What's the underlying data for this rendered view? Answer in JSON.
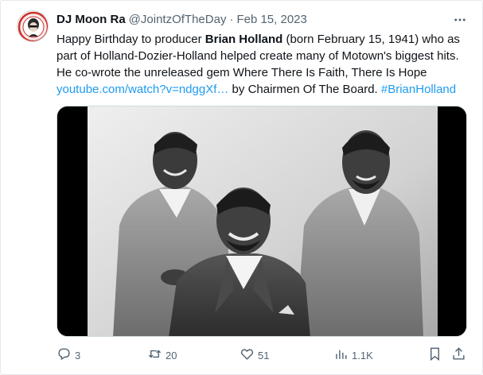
{
  "author": {
    "name": "DJ Moon Ra",
    "handle": "@JointzOfTheDay",
    "separator": "·",
    "date": "Feb 15, 2023"
  },
  "tweet": {
    "part1": "Happy Birthday to producer ",
    "bold_name": "Brian Holland",
    "part2": " (born February 15, 1941) who as part of Holland-Dozier-Holland helped create many of Motown's biggest hits. He co-wrote the unreleased gem Where There Is Faith, There Is Hope ",
    "link": "youtube.com/watch?v=ndggXf…",
    "part3": " by Chairmen Of The Board. ",
    "hashtag": "#BrianHolland"
  },
  "actions": {
    "replies": "3",
    "reposts": "20",
    "likes": "51",
    "views": "1.1K"
  },
  "icons": {
    "more": "more-icon",
    "reply": "reply-icon",
    "repost": "repost-icon",
    "like": "heart-icon",
    "views": "views-icon",
    "bookmark": "bookmark-icon",
    "share": "share-icon"
  },
  "colors": {
    "text": "#0f1419",
    "secondary": "#536471",
    "link": "#1d9bf0"
  }
}
